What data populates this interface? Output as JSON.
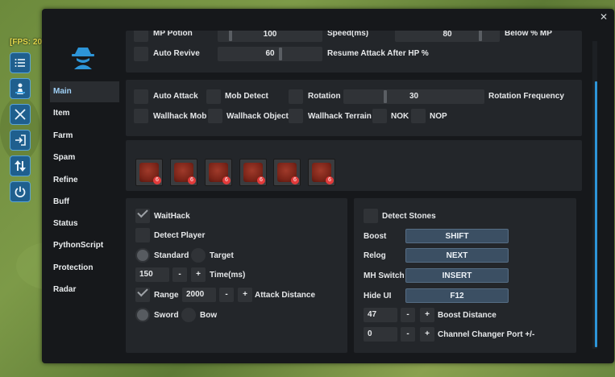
{
  "hud": {
    "fps_label": "[FPS: 20"
  },
  "window": {
    "close_icon": "✕"
  },
  "nav": [
    {
      "label": "Main",
      "active": true
    },
    {
      "label": "Item"
    },
    {
      "label": "Farm"
    },
    {
      "label": "Spam"
    },
    {
      "label": "Refine"
    },
    {
      "label": "Buff"
    },
    {
      "label": "Status"
    },
    {
      "label": "PythonScript"
    },
    {
      "label": "Protection"
    },
    {
      "label": "Radar"
    }
  ],
  "top_panel": {
    "mp_potion_label": "MP Potion",
    "mp_potion_value": "100",
    "speed_label": "Speed(ms)",
    "speed_value": "80",
    "below_mp_label": "Below % MP",
    "auto_revive_label": "Auto Revive",
    "auto_revive_value": "60",
    "resume_label": "Resume Attack After HP %"
  },
  "attack_panel": {
    "auto_attack": "Auto Attack",
    "mob_detect": "Mob Detect",
    "rotation": "Rotation",
    "rotation_value": "30",
    "rotation_frequency": "Rotation Frequency",
    "wallhack_mob": "Wallhack Mob",
    "wallhack_object": "Wallhack Object",
    "wallhack_terrain": "Wallhack Terrain",
    "nok": "NOK",
    "nop": "NOP"
  },
  "skills": {
    "count": 6,
    "badge": "6"
  },
  "left_panel": {
    "waithack": "WaitHack",
    "waithack_checked": true,
    "detect_player": "Detect Player",
    "standard": "Standard",
    "target": "Target",
    "time_value": "150",
    "minus": "-",
    "plus": "+",
    "time_label": "Time(ms)",
    "range": "Range",
    "range_checked": true,
    "range_value": "2000",
    "attack_distance": "Attack Distance",
    "sword": "Sword",
    "bow": "Bow"
  },
  "right_panel": {
    "detect_stones": "Detect Stones",
    "boost_label": "Boost",
    "boost_key": "SHIFT",
    "relog_label": "Relog",
    "relog_key": "NEXT",
    "mh_switch_label": "MH Switch",
    "mh_switch_key": "INSERT",
    "hide_ui_label": "Hide UI",
    "hide_ui_key": "F12",
    "boost_distance_value": "47",
    "boost_distance_label": "Boost Distance",
    "channel_value": "0",
    "channel_label": "Channel Changer Port +/-",
    "minus": "-",
    "plus": "+"
  },
  "colors": {
    "accent": "#2d95d8",
    "panel": "#23262a",
    "window": "#16181b",
    "key_button": "#3b4f63"
  }
}
